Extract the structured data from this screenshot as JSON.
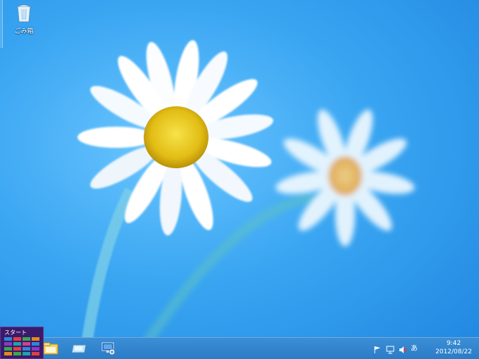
{
  "desktop": {
    "icons": [
      {
        "label": "ごみ箱",
        "icon": "recycle-bin-icon"
      }
    ]
  },
  "start_tip": {
    "label": "スタート"
  },
  "taskbar": {
    "pinned": [
      {
        "icon": "file-explorer-icon"
      },
      {
        "icon": "folder-window-icon"
      },
      {
        "icon": "remote-desktop-icon"
      }
    ]
  },
  "tray": {
    "ime": "あ",
    "time": "9:42",
    "date": "2012/08/22",
    "icons": [
      "action-center-flag-icon",
      "network-icon",
      "volume-muted-icon"
    ]
  },
  "colors": {
    "wallpaper_blue": "#3aa6f2",
    "taskbar": "#2a7cc6",
    "start_tip": "#3a1a6b"
  }
}
